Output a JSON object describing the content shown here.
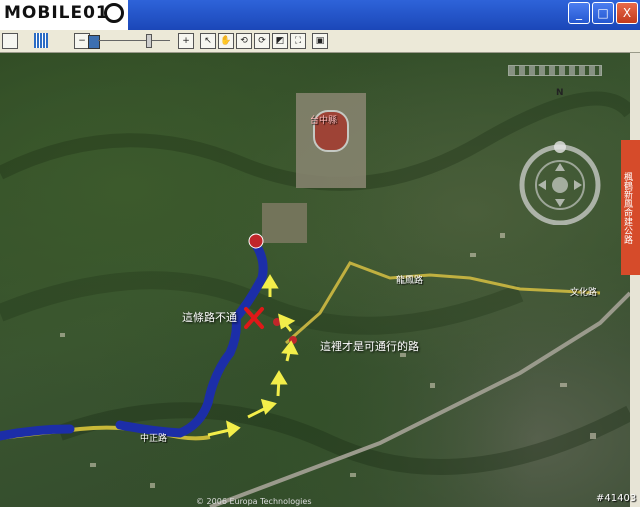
{
  "app": {
    "logo_text": "MOBILE01"
  },
  "window": {
    "btn_minimize": "_",
    "btn_maximize": "□",
    "btn_close": "X"
  },
  "toolbar": {
    "zoom_out": "−",
    "zoom_in": "+"
  },
  "map": {
    "annotations": {
      "blocked_road": "這條路不通",
      "passable_road": "這裡才是可通行的路"
    },
    "place_labels": {
      "road_a": "龍鳳路",
      "road_b": "文化路",
      "road_c": "中正路",
      "area_a": "台中縣"
    },
    "side_strip_text": "楓鶴新鳳命建公路",
    "copyright": "© 2006 Europa Technologies",
    "nav_north": "N"
  },
  "watermark": "#41403",
  "colors": {
    "route_blue": "#1c2ea8",
    "arrow_yellow": "#f3ee4a",
    "cross_red": "#e01818"
  }
}
